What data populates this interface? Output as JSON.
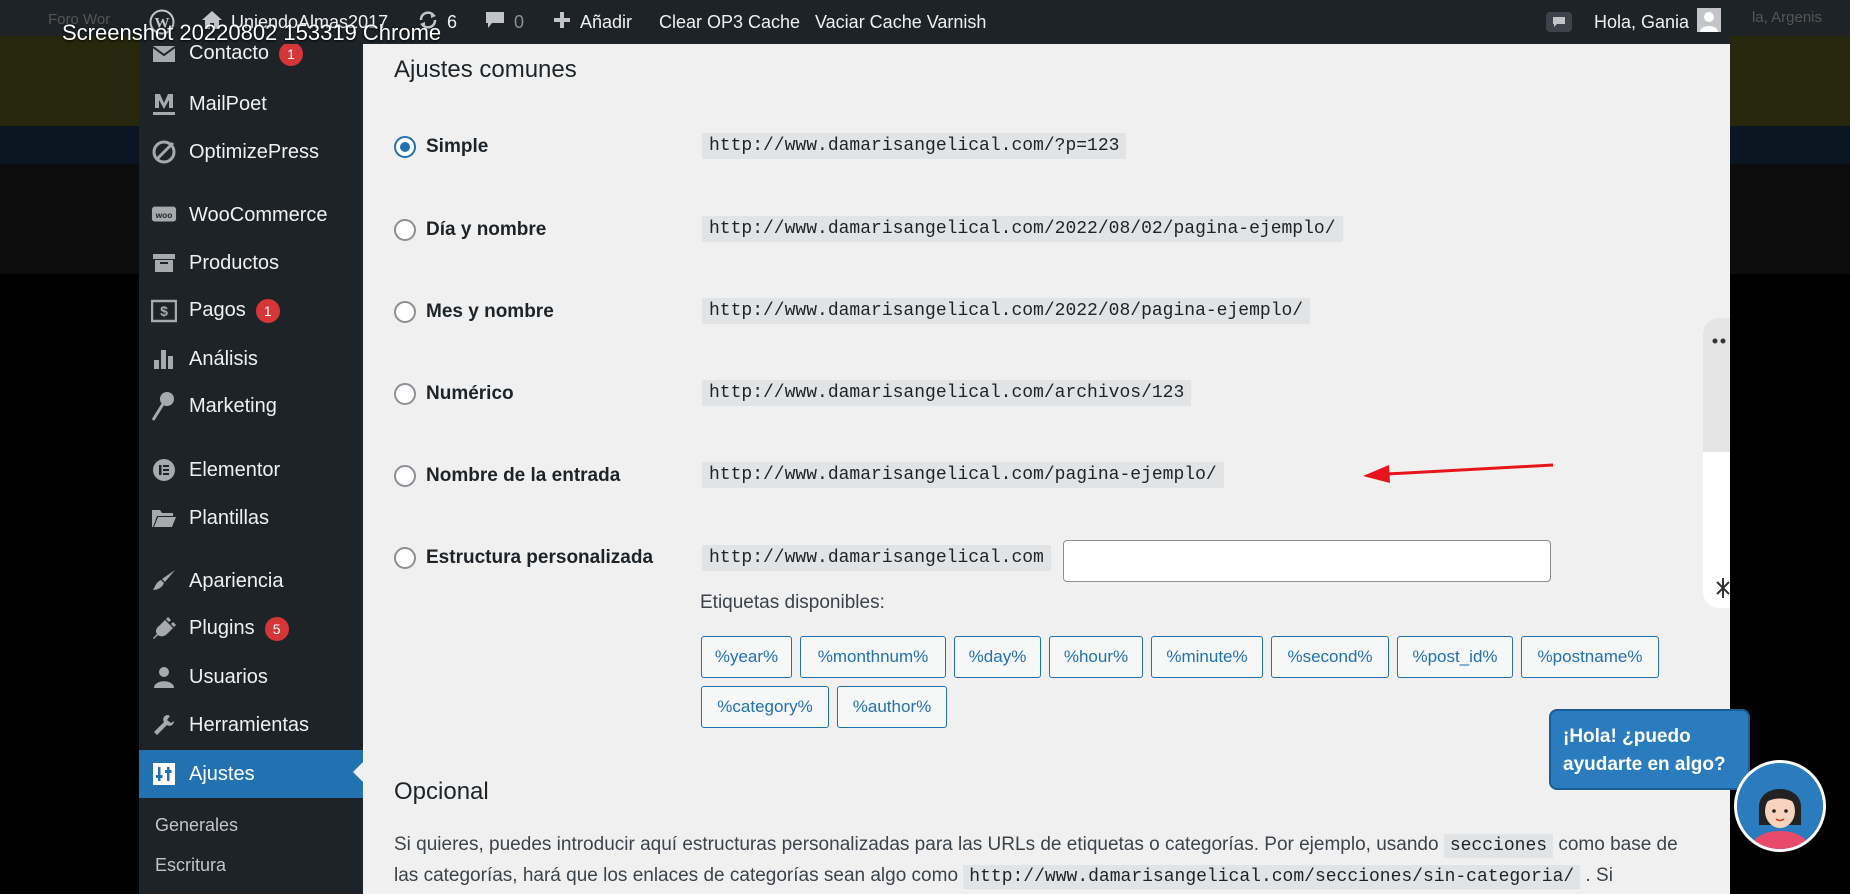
{
  "overlay": {
    "video_title": "Screenshot 20220802 153319 Chrome",
    "bg_left_text": "Foro Wor",
    "bg_right_text": "la, Argenis"
  },
  "adminbar": {
    "site_name": "UniendoAlmas2017",
    "updates_count": "6",
    "comments_count": "0",
    "new_label": "Añadir",
    "clear_op3": "Clear OP3 Cache",
    "varnish": "Vaciar Cache Varnish",
    "greeting": "Hola, Gania"
  },
  "sidebar": {
    "items": [
      {
        "label": "Contacto",
        "badge": "1",
        "icon": "envelope-icon"
      },
      {
        "label": "MailPoet",
        "icon": "mailpoet-icon"
      },
      {
        "label": "OptimizePress",
        "icon": "optimizepress-icon"
      },
      {
        "label": "WooCommerce",
        "icon": "woo-icon"
      },
      {
        "label": "Productos",
        "icon": "archive-icon"
      },
      {
        "label": "Pagos",
        "badge": "1",
        "icon": "dollar-icon"
      },
      {
        "label": "Análisis",
        "icon": "bar-chart-icon"
      },
      {
        "label": "Marketing",
        "icon": "megaphone-icon"
      },
      {
        "label": "Elementor",
        "icon": "elementor-icon"
      },
      {
        "label": "Plantillas",
        "icon": "folder-icon"
      },
      {
        "label": "Apariencia",
        "icon": "brush-icon"
      },
      {
        "label": "Plugins",
        "badge": "5",
        "icon": "plug-icon"
      },
      {
        "label": "Usuarios",
        "icon": "user-icon"
      },
      {
        "label": "Herramientas",
        "icon": "wrench-icon"
      },
      {
        "label": "Ajustes",
        "icon": "settings-icon",
        "active": true
      }
    ],
    "submenu": [
      "Generales",
      "Escritura"
    ]
  },
  "content": {
    "section_title": "Ajustes comunes",
    "options": [
      {
        "label": "Simple",
        "url": "http://www.damarisangelical.com/?p=123",
        "checked": true
      },
      {
        "label": "Día y nombre",
        "url": "http://www.damarisangelical.com/2022/08/02/pagina-ejemplo/",
        "checked": false
      },
      {
        "label": "Mes y nombre",
        "url": "http://www.damarisangelical.com/2022/08/pagina-ejemplo/",
        "checked": false
      },
      {
        "label": "Numérico",
        "url": "http://www.damarisangelical.com/archivos/123",
        "checked": false
      },
      {
        "label": "Nombre de la entrada",
        "url": "http://www.damarisangelical.com/pagina-ejemplo/",
        "checked": false
      },
      {
        "label": "Estructura personalizada",
        "url": "http://www.damarisangelical.com",
        "checked": false
      }
    ],
    "custom_value": "",
    "tags_label": "Etiquetas disponibles:",
    "tags": [
      "%year%",
      "%monthnum%",
      "%day%",
      "%hour%",
      "%minute%",
      "%second%",
      "%post_id%",
      "%postname%",
      "%category%",
      "%author%"
    ],
    "optional_title": "Opcional",
    "optional_text_1": "Si quieres, puedes introducir aquí estructuras personalizadas para las URLs de etiquetas o categorías. Por ejemplo, usando ",
    "optional_code_1": "secciones",
    "optional_text_2": " como base de las categorías, hará que los enlaces de categorías sean algo como ",
    "optional_code_2": "http://www.damarisangelical.com/secciones/sin-categoria/",
    "optional_text_3": " . Si"
  },
  "chat": {
    "line1": "¡Hola! ¿puedo",
    "line2": "ayudarte en algo?"
  },
  "colors": {
    "accent": "#2271b1",
    "sidebar_bg": "#1d2327",
    "badge": "#d63638",
    "arrow": "#e8141c"
  }
}
